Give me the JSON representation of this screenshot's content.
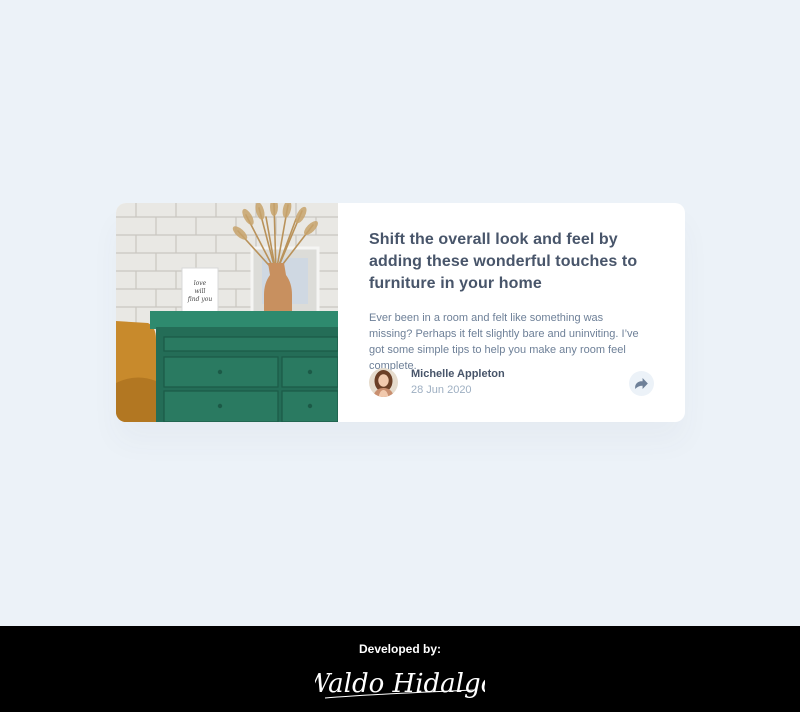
{
  "card": {
    "image_alt": "green drawer cabinet with vase and picture frame",
    "frame_text": "love will find you",
    "title": "Shift the overall look and feel by adding these wonderful touches to furniture in your home",
    "description": "Ever been in a room and felt like something was missing? Perhaps it felt slightly bare and uninviting. I’ve got some simple tips to help you make any room feel complete.",
    "author": {
      "name": "Michelle Appleton",
      "date": "28 Jun 2020"
    },
    "share_icon": "share-arrow-icon"
  },
  "footer": {
    "label": "Developed by:",
    "signature": "Waldo Hidalgo"
  },
  "colors": {
    "background": "#ecf2f8",
    "title": "#48556a",
    "text": "#6e8098",
    "muted": "#9eafc2",
    "footer": "#000000"
  }
}
